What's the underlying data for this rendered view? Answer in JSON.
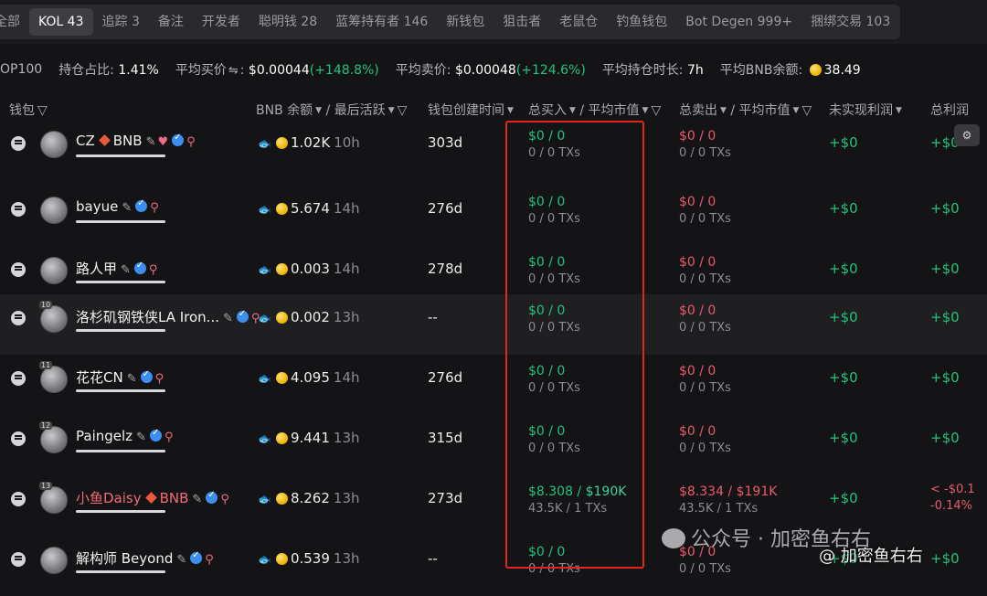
{
  "tabs": [
    {
      "label": "全部"
    },
    {
      "label": "KOL 43",
      "active": true
    },
    {
      "label": "追踪 3"
    },
    {
      "label": "备注"
    },
    {
      "label": "开发者"
    },
    {
      "label": "聪明钱 28"
    },
    {
      "label": "蓝筹持有者 146"
    },
    {
      "label": "新钱包"
    },
    {
      "label": "狙击者"
    },
    {
      "label": "老鼠仓"
    },
    {
      "label": "钓鱼钱包"
    },
    {
      "label": "Bot Degen 999+"
    },
    {
      "label": "捆绑交易 103"
    }
  ],
  "stats": {
    "top_label": "OP100",
    "hold_label": "持仓占比:",
    "hold_val": "1.41%",
    "avgbuy_label": "平均买价",
    "avgbuy_val": "$0.00044",
    "avgbuy_pct": "(+148.8%)",
    "avgsell_label": "平均卖价:",
    "avgsell_val": "$0.00048",
    "avgsell_pct": "(+124.6%)",
    "hold_time_label": "平均持仓时长:",
    "hold_time_val": "7h",
    "bnb_label": "平均BNB余额:",
    "bnb_val": "38.49"
  },
  "headers": {
    "wallet": "钱包",
    "bnb": "BNB 余额",
    "last_active": "最后活跃",
    "created": "钱包创建时间",
    "total_buy": "总买入",
    "avg_mcap_buy": "平均市值",
    "total_sell": "总卖出",
    "avg_mcap_sell": "平均市值",
    "unrealized": "未实现利润",
    "total_profit": "总利润"
  },
  "rows": [
    {
      "rank": "",
      "name": "CZ",
      "suffix": "BNB",
      "has_diamond": true,
      "has_heart": true,
      "name_red": false,
      "bnb": "1.02K",
      "time": "10h",
      "created": "303d",
      "buy": "$0 / 0",
      "buy_sub": "0 / 0 TXs",
      "sell": "$0 / 0",
      "sell_sub": "0 / 0 TXs",
      "unreal": "+$0",
      "total": "+$0"
    },
    {
      "rank": "",
      "name": "bayue",
      "suffix": "",
      "has_diamond": false,
      "has_heart": false,
      "name_red": false,
      "bnb": "5.674",
      "time": "14h",
      "created": "276d",
      "buy": "$0 / 0",
      "buy_sub": "0 / 0 TXs",
      "sell": "$0 / 0",
      "sell_sub": "0 / 0 TXs",
      "unreal": "+$0",
      "total": "+$0"
    },
    {
      "rank": "",
      "name": "路人甲",
      "suffix": "",
      "has_diamond": false,
      "has_heart": false,
      "name_red": false,
      "bnb": "0.003",
      "time": "14h",
      "created": "278d",
      "buy": "$0 / 0",
      "buy_sub": "0 / 0 TXs",
      "sell": "$0 / 0",
      "sell_sub": "0 / 0 TXs",
      "unreal": "+$0",
      "total": "+$0"
    },
    {
      "rank": "10",
      "name": "洛杉矶钢铁侠LA Iron...",
      "suffix": "",
      "has_diamond": false,
      "has_heart": false,
      "name_red": false,
      "bnb": "0.002",
      "time": "13h",
      "created": "--",
      "buy": "$0 / 0",
      "buy_sub": "0 / 0 TXs",
      "sell": "$0 / 0",
      "sell_sub": "0 / 0 TXs",
      "unreal": "+$0",
      "total": "+$0"
    },
    {
      "rank": "11",
      "name": "花花CN",
      "suffix": "",
      "has_diamond": false,
      "has_heart": false,
      "name_red": false,
      "bnb": "4.095",
      "time": "14h",
      "created": "276d",
      "buy": "$0 / 0",
      "buy_sub": "0 / 0 TXs",
      "sell": "$0 / 0",
      "sell_sub": "0 / 0 TXs",
      "unreal": "+$0",
      "total": "+$0"
    },
    {
      "rank": "12",
      "name": "Paingelz",
      "suffix": "",
      "has_diamond": false,
      "has_heart": false,
      "name_red": false,
      "bnb": "9.441",
      "time": "13h",
      "created": "315d",
      "buy": "$0 / 0",
      "buy_sub": "0 / 0 TXs",
      "sell": "$0 / 0",
      "sell_sub": "0 / 0 TXs",
      "unreal": "+$0",
      "total": "+$0"
    },
    {
      "rank": "13",
      "name": "小鱼Daisy",
      "suffix": "BNB",
      "has_diamond": true,
      "has_heart": false,
      "name_red": true,
      "bnb": "8.262",
      "time": "13h",
      "created": "273d",
      "buy": "$8.308 / ",
      "buy_b": "$190K",
      "buy_sub": "43.5K / 1 TXs",
      "sell": "$8.334 / $191K",
      "sell_sub": "43.5K / 1 TXs",
      "unreal": "+$0",
      "total": "< -$0.1",
      "total_sub": "-0.14%"
    },
    {
      "rank": "",
      "name": "解构师 Beyond",
      "suffix": "",
      "has_diamond": false,
      "has_heart": false,
      "name_red": false,
      "bnb": "0.539",
      "time": "13h",
      "created": "--",
      "buy": "$0 / 0",
      "buy_sub": "0 / 0 TXs",
      "sell": "$0 / 0",
      "sell_sub": "0 / 0 TXs",
      "unreal": "+$0",
      "total": "+$0"
    }
  ],
  "watermark": {
    "text": "公众号 · 加密鱼右右",
    "handle": "@ 加密鱼右右"
  }
}
